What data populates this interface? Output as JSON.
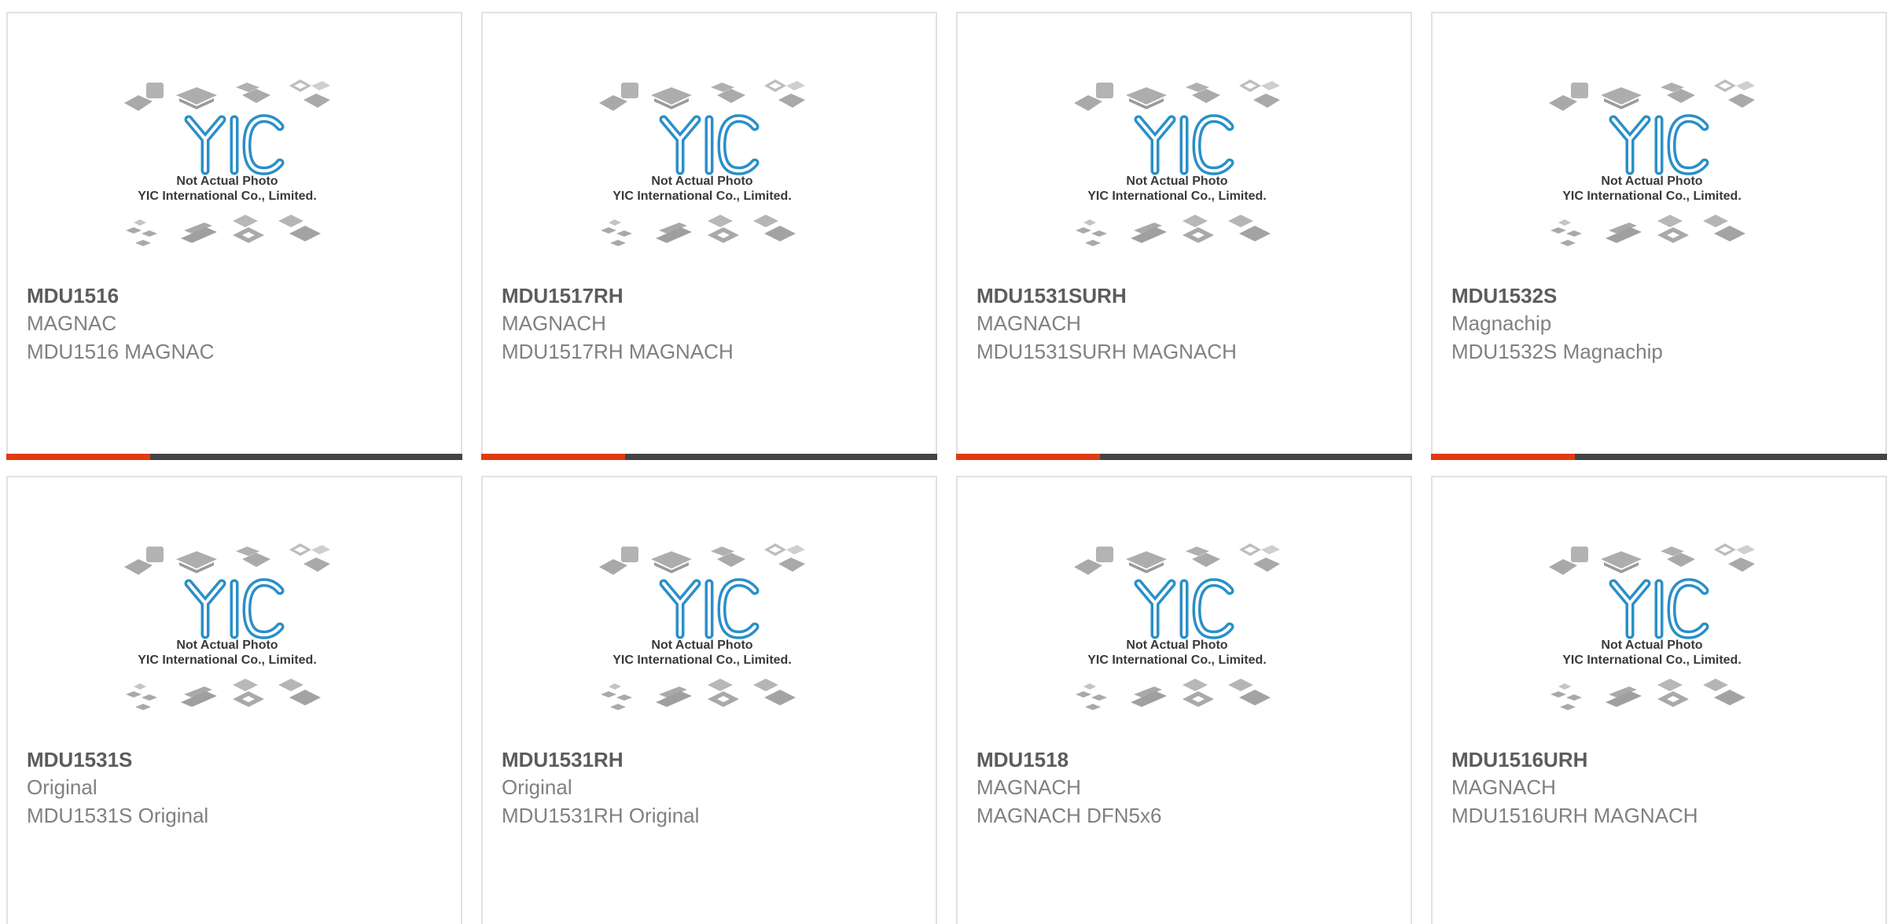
{
  "colors": {
    "accent": "#e03c12",
    "bar": "#444444",
    "title": "#5c5c5c",
    "subtitle": "#808080",
    "logo_blue": "#2a8fc9",
    "border": "#e2e2e2"
  },
  "placeholder": {
    "line1": "Not Actual Photo",
    "line2": "YIC International Co., Limited.",
    "logo_text": "YIC"
  },
  "products": [
    {
      "part": "MDU1516",
      "manufacturer": "MAGNAC",
      "description": "MDU1516 MAGNAC",
      "progress": 0.315
    },
    {
      "part": "MDU1517RH",
      "manufacturer": "MAGNACH",
      "description": "MDU1517RH MAGNACH",
      "progress": 0.315
    },
    {
      "part": "MDU1531SURH",
      "manufacturer": "MAGNACH",
      "description": "MDU1531SURH MAGNACH",
      "progress": 0.315
    },
    {
      "part": "MDU1532S",
      "manufacturer": "Magnachip",
      "description": "MDU1532S Magnachip",
      "progress": 0.315
    },
    {
      "part": "MDU1531S",
      "manufacturer": "Original",
      "description": "MDU1531S Original"
    },
    {
      "part": "MDU1531RH",
      "manufacturer": "Original",
      "description": "MDU1531RH Original"
    },
    {
      "part": "MDU1518",
      "manufacturer": "MAGNACH",
      "description": "MAGNACH DFN5x6"
    },
    {
      "part": "MDU1516URH",
      "manufacturer": "MAGNACH",
      "description": "MDU1516URH MAGNACH"
    }
  ]
}
